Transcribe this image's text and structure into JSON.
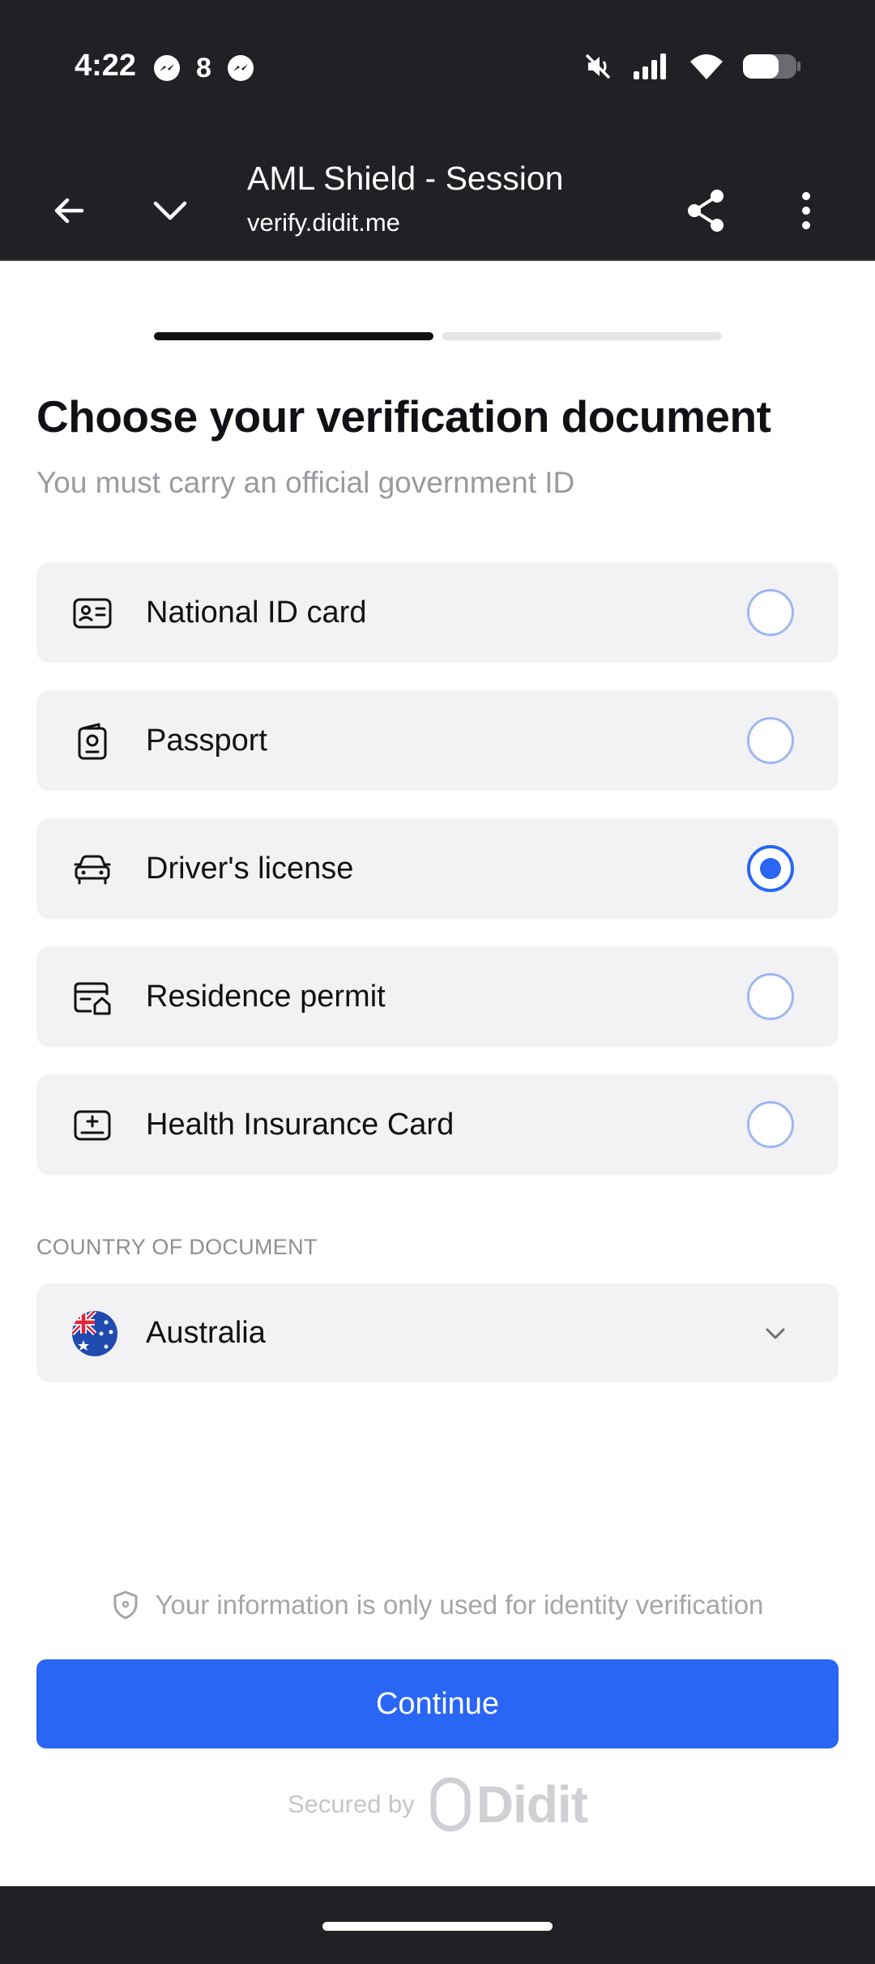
{
  "status_bar": {
    "time": "4:22",
    "notification_count": "8",
    "icons": [
      "messenger-icon",
      "messenger-icon",
      "mute-icon",
      "signal-icon",
      "wifi-icon",
      "battery-icon"
    ]
  },
  "browser": {
    "title": "AML Shield - Session",
    "url": "verify.didit.me"
  },
  "progress": {
    "current_step": 1,
    "total_steps": 2
  },
  "heading": {
    "title": "Choose your verification document",
    "subtitle": "You must carry an official government ID"
  },
  "documents": [
    {
      "label": "National ID card",
      "icon": "id-card-icon",
      "selected": false
    },
    {
      "label": "Passport",
      "icon": "passport-icon",
      "selected": false
    },
    {
      "label": "Driver's license",
      "icon": "car-icon",
      "selected": true
    },
    {
      "label": "Residence permit",
      "icon": "residence-permit-icon",
      "selected": false
    },
    {
      "label": "Health Insurance Card",
      "icon": "health-card-icon",
      "selected": false
    }
  ],
  "country": {
    "section_label": "COUNTRY OF DOCUMENT",
    "selected": "Australia",
    "flag_icon": "australia-flag-icon"
  },
  "footer": {
    "info_text": "Your information is only used for identity verification",
    "continue_label": "Continue",
    "secured_by": "Secured by",
    "brand": "Didit"
  },
  "colors": {
    "accent": "#2966f5",
    "chrome_bg": "#202124",
    "option_bg": "#f2f2f5",
    "muted_text": "#9a9aa0"
  }
}
